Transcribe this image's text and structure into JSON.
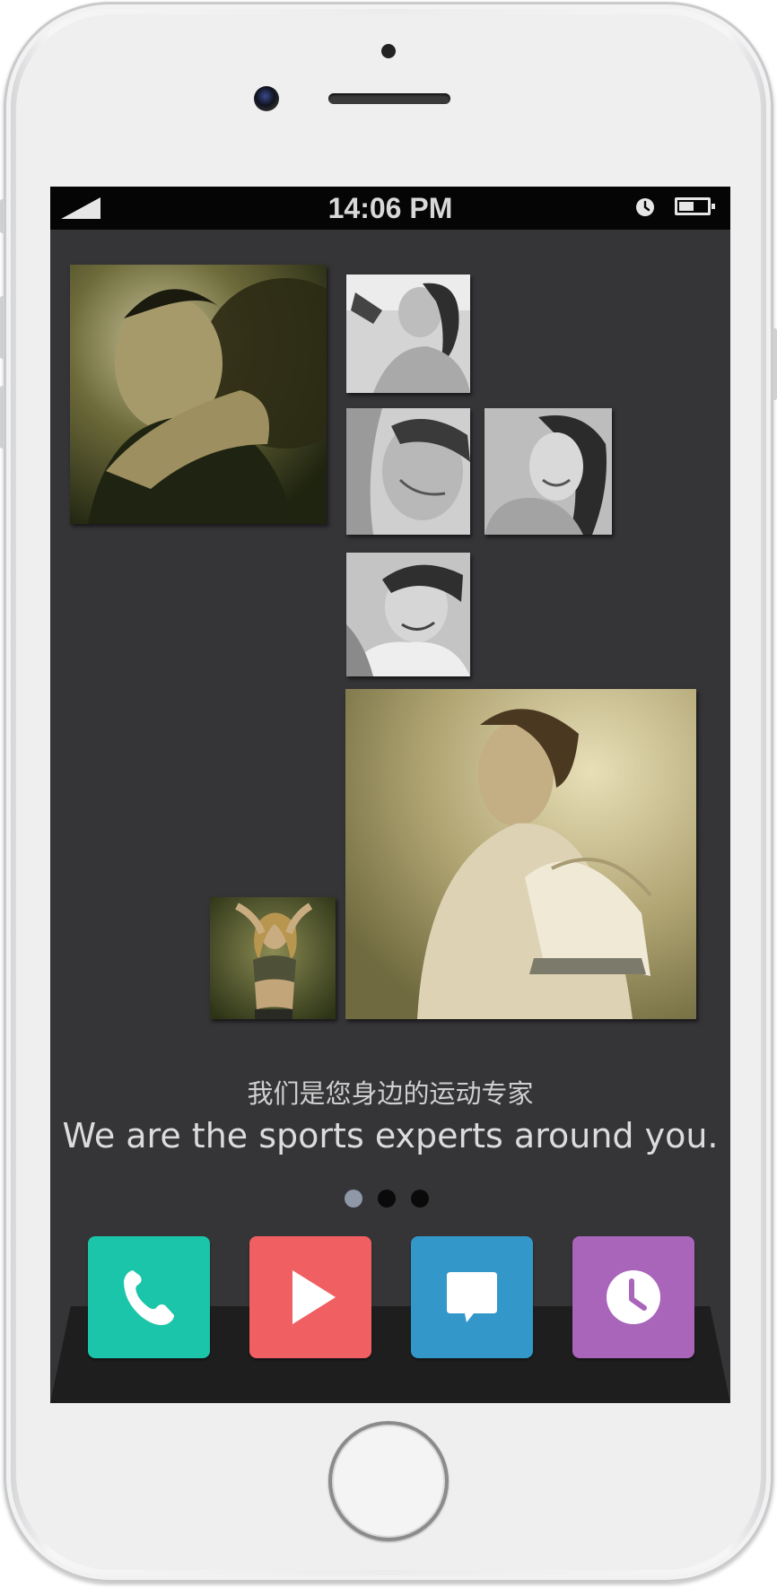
{
  "status_bar": {
    "time": "14:06 PM"
  },
  "gallery": {
    "photos": [
      {
        "name": "basketball-player",
        "tone": "sepia-green"
      },
      {
        "name": "woman-exercising",
        "tone": "grayscale"
      },
      {
        "name": "man-lifting",
        "tone": "grayscale"
      },
      {
        "name": "smiling-woman",
        "tone": "grayscale"
      },
      {
        "name": "smiling-man",
        "tone": "grayscale"
      },
      {
        "name": "woman-with-skates",
        "tone": "sepia"
      },
      {
        "name": "fitness-woman",
        "tone": "sepia-green"
      }
    ]
  },
  "tagline": {
    "chinese": "我们是您身边的运动专家",
    "english": "We are the sports experts around you."
  },
  "pager": {
    "pages": 3,
    "active": 1
  },
  "dock": {
    "items": [
      {
        "icon": "phone-icon",
        "color": "#1bc5a9"
      },
      {
        "icon": "play-icon",
        "color": "#f05f61"
      },
      {
        "icon": "chat-icon",
        "color": "#3398c9"
      },
      {
        "icon": "clock-icon",
        "color": "#a965ba"
      }
    ]
  },
  "colors": {
    "screen_bg": "#353437",
    "status_bar_bg": "#050505",
    "dock_shelf": "#1e1e1f"
  }
}
